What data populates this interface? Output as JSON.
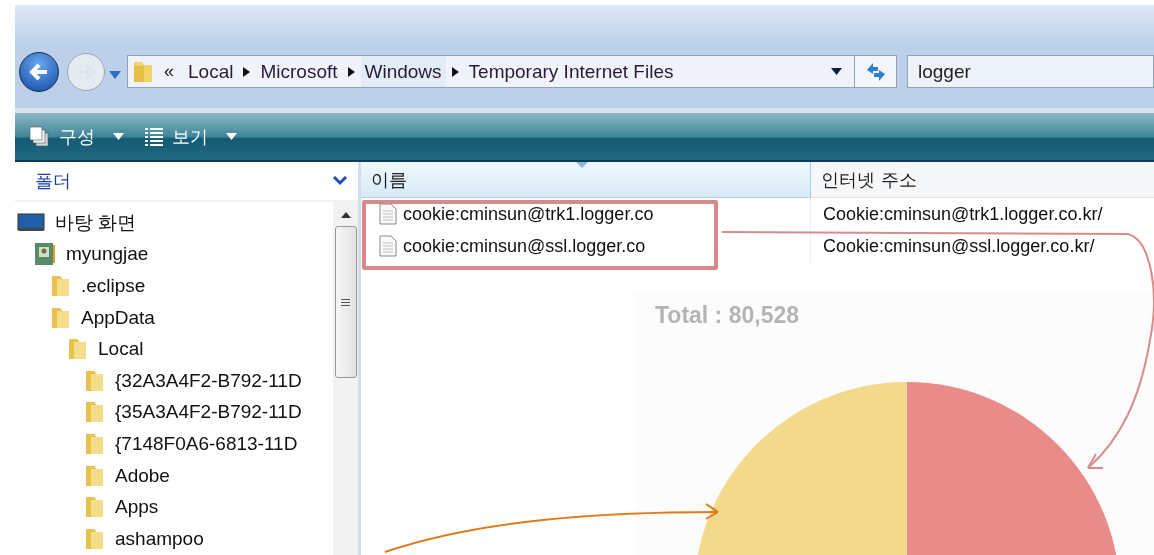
{
  "address_bar": {
    "overflow": "«",
    "crumbs": [
      "Local",
      "Microsoft",
      "Windows",
      "Temporary Internet Files"
    ]
  },
  "search": {
    "value": "logger"
  },
  "toolbar": [
    {
      "label": "구성",
      "kind": "organize"
    },
    {
      "label": "보기",
      "kind": "views"
    }
  ],
  "folder_pane": {
    "title": "폴더",
    "tree": [
      {
        "name": "바탕 화면",
        "kind": "desktop",
        "children": [
          {
            "name": "myungjae",
            "kind": "user",
            "children": [
              {
                "name": ".eclipse",
                "kind": "folder"
              },
              {
                "name": "AppData",
                "kind": "folder",
                "children": [
                  {
                    "name": "Local",
                    "kind": "folder",
                    "children": [
                      {
                        "name": "{32A3A4F2-B792-11D",
                        "kind": "folder"
                      },
                      {
                        "name": "{35A3A4F2-B792-11D",
                        "kind": "folder"
                      },
                      {
                        "name": "{7148F0A6-6813-11D",
                        "kind": "folder"
                      },
                      {
                        "name": "Adobe",
                        "kind": "folder"
                      },
                      {
                        "name": "Apps",
                        "kind": "folder"
                      },
                      {
                        "name": "ashampoo",
                        "kind": "folder"
                      }
                    ]
                  }
                ]
              }
            ]
          }
        ]
      }
    ]
  },
  "file_list": {
    "columns": [
      "이름",
      "인터넷 주소"
    ],
    "rows": [
      {
        "name": "cookie:cminsun@trk1.logger.co",
        "address": "Cookie:cminsun@trk1.logger.co.kr/"
      },
      {
        "name": "cookie:cminsun@ssl.logger.co",
        "address": "Cookie:cminsun@ssl.logger.co.kr/"
      }
    ]
  },
  "overlay": {
    "total": "Total : 80,528"
  }
}
